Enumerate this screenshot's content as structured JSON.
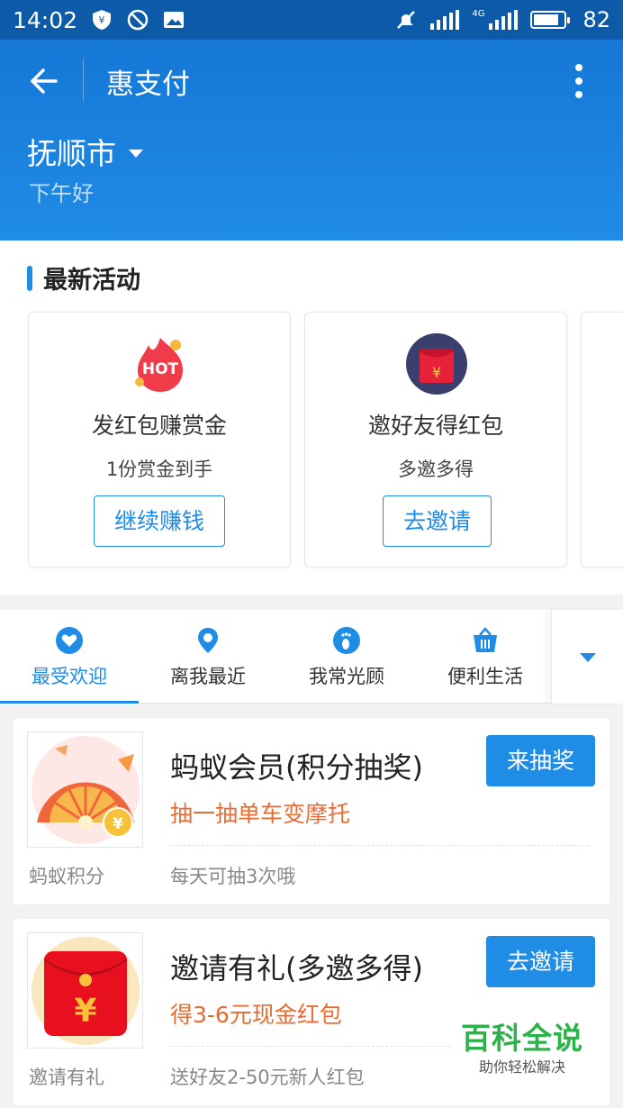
{
  "status_bar": {
    "time": "14:02",
    "battery_level": "82",
    "battery_fill": 0.82,
    "network": "4G"
  },
  "header": {
    "title": "惠支付",
    "city": "抚顺市",
    "greeting": "下午好"
  },
  "activities": {
    "section_title": "最新活动",
    "cards": [
      {
        "icon": "hot-icon",
        "badge": "HOT",
        "title": "发红包赚赏金",
        "subtitle": "1份赏金到手",
        "button": "继续赚钱"
      },
      {
        "icon": "red-envelope-icon",
        "badge": "¥",
        "title": "邀好友得红包",
        "subtitle": "多邀多得",
        "button": "去邀请"
      }
    ]
  },
  "tabs": [
    {
      "label": "最受欢迎",
      "icon": "heart-icon",
      "active": true
    },
    {
      "label": "离我最近",
      "icon": "location-pin-icon",
      "active": false
    },
    {
      "label": "我常光顾",
      "icon": "footprint-icon",
      "active": false
    },
    {
      "label": "便利生活",
      "icon": "basket-icon",
      "active": false
    }
  ],
  "deals": [
    {
      "shop": "蚂蚁积分",
      "title": "蚂蚁会员(积分抽奖)",
      "subtitle": "抽一抽单车变摩托",
      "note": "每天可抽3次哦",
      "button": "来抽奖",
      "thumb_badge": "¥"
    },
    {
      "shop": "邀请有礼",
      "title": "邀请有礼(多邀多得)",
      "subtitle": "得3-6元现金红包",
      "note": "送好友2-50元新人红包",
      "button": "去邀请",
      "thumb_badge": "¥"
    }
  ],
  "watermark": {
    "line1": "百科全说",
    "line2": "助你轻松解决"
  },
  "colors": {
    "primary": "#1f8ce6",
    "header_dark": "#0d5aa8",
    "accent_orange": "#e86b32",
    "watermark_green": "#2bb34a"
  }
}
